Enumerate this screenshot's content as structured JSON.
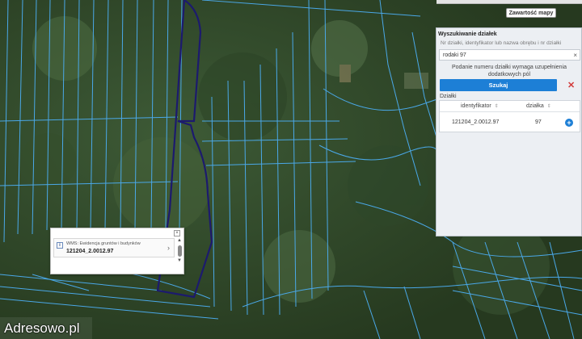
{
  "map": {
    "legend_button": "Zawartość mapy"
  },
  "search_panel": {
    "title": "Wyszukiwanie działek",
    "hint": "Nr działki, identyfikator lub nazwa obrębu i nr działki",
    "query": "rodaki 97",
    "note": "Podanie numeru działki wymaga uzupełnienia dodatkowych pól",
    "search_button": "Szukaj",
    "results_label": "Działki",
    "columns": [
      "identyfikator",
      "działka"
    ],
    "rows": [
      {
        "id": "121204_2.0012.97",
        "parcel": "97"
      }
    ]
  },
  "popup": {
    "layer": "WMS: Ewidencja gruntów i budynków",
    "identifier": "121204_2.0012.97"
  },
  "watermark": "Adresowo.pl",
  "colors": {
    "parcel_lines": "#4aa8e8",
    "selected_parcel": "#1c1a6e",
    "button": "#1d7fd6"
  }
}
